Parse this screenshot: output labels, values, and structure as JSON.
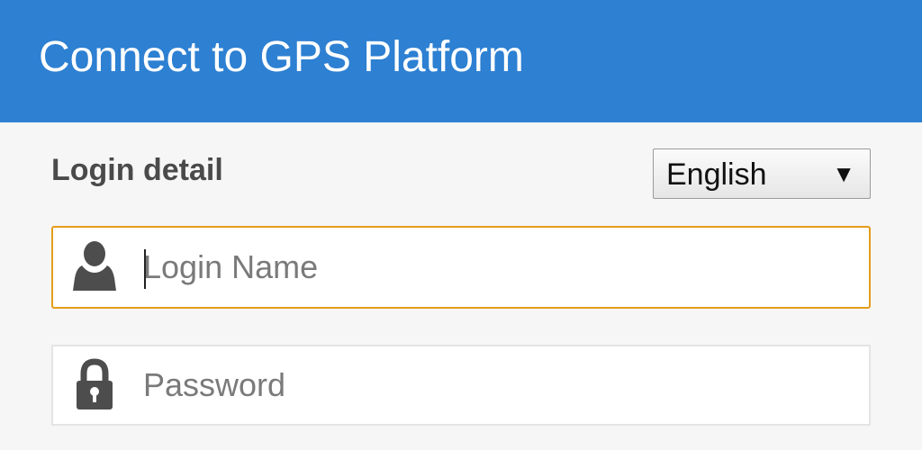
{
  "header": {
    "title": "Connect to GPS Platform"
  },
  "form": {
    "section_title": "Login detail",
    "language": {
      "selected": "English",
      "caret": "▼"
    },
    "login_name": {
      "placeholder": "Login Name",
      "icon": "user-icon"
    },
    "password": {
      "placeholder": "Password",
      "icon": "lock-icon"
    }
  },
  "colors": {
    "header_bg": "#2d80d2",
    "focus_border": "#e59c1a"
  }
}
